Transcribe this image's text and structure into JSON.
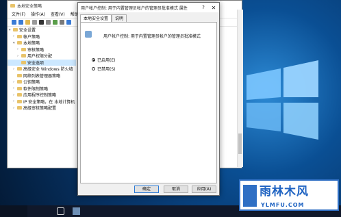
{
  "mmc": {
    "title": "本地安全策略",
    "menu": [
      "文件(F)",
      "操作(A)",
      "查看(V)",
      "帮助(H)"
    ],
    "tree": [
      {
        "label": "安全设置",
        "level": 0,
        "expanded": true
      },
      {
        "label": "帐户策略",
        "level": 1
      },
      {
        "label": "本地策略",
        "level": 1,
        "expanded": true
      },
      {
        "label": "审核策略",
        "level": 2
      },
      {
        "label": "用户权限分配",
        "level": 2
      },
      {
        "label": "安全选项",
        "level": 2,
        "selected": true
      },
      {
        "label": "高级安全 Windows 防火墙",
        "level": 1
      },
      {
        "label": "网络列表管理器策略",
        "level": 1
      },
      {
        "label": "公钥策略",
        "level": 1
      },
      {
        "label": "软件限制策略",
        "level": 1
      },
      {
        "label": "应用程序控制策略",
        "level": 1
      },
      {
        "label": "IP 安全策略，在 本地计算机",
        "level": 1
      },
      {
        "label": "高级审核策略配置",
        "level": 1
      }
    ]
  },
  "dialog": {
    "title": "用户帐户控制: 用于内置管理员帐户的管理员批准模式 属性",
    "help": "?",
    "close": "✕",
    "tabs": [
      "本地安全设置",
      "说明"
    ],
    "policy_name": "用户帐户控制: 用于内置管理员帐户的管理员批准模式",
    "options": [
      {
        "label": "已启用(E)",
        "checked": true
      },
      {
        "label": "已禁用(S)",
        "checked": false
      }
    ],
    "buttons": {
      "ok": "确定",
      "cancel": "取消",
      "apply": "应用(A)"
    }
  },
  "watermark": {
    "name": "雨林木风",
    "url": "YLMFU.COM"
  },
  "colors": {
    "desktop_accent": "#2d8bd6",
    "taskbar": "#10182a",
    "watermark": "#1f63c2"
  }
}
